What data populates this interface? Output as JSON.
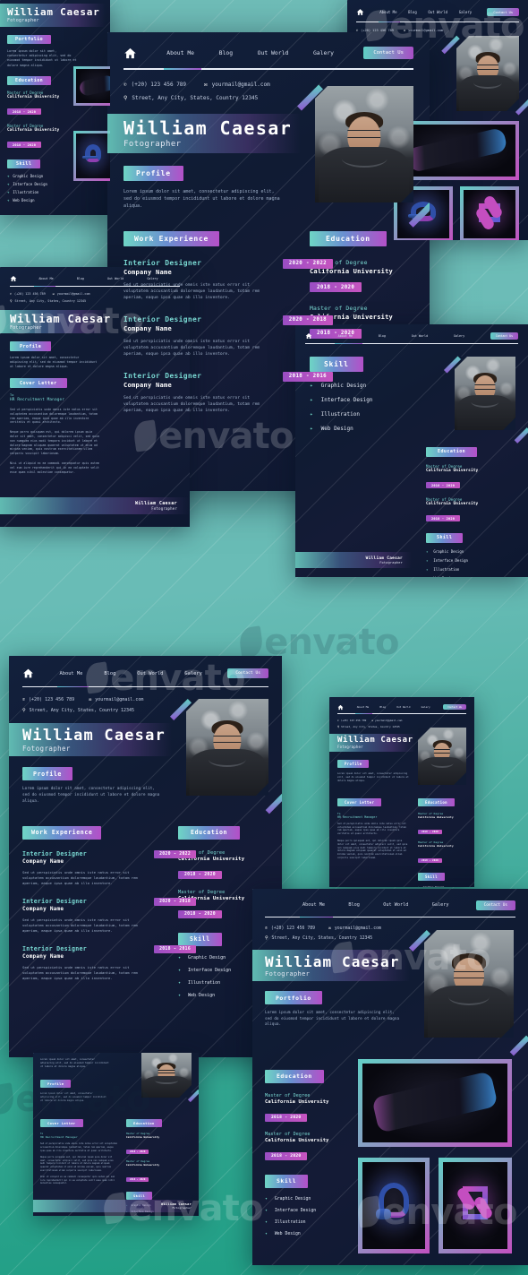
{
  "background": {
    "color_top": "#6fbdb8",
    "color_bottom": "#1f9e84"
  },
  "brand": {
    "accent_teal": "#6fd5c5",
    "accent_purple": "#b450c8",
    "accent_pink": "#c654c0",
    "card_bg": "#101b33"
  },
  "watermark": {
    "text": "envato"
  },
  "nav": {
    "home_icon": "home-icon",
    "links": [
      "About Me",
      "Blog",
      "Out World",
      "Galery"
    ],
    "cta": "Contact Us"
  },
  "contact": {
    "phone_icon": "phone-icon",
    "phone": "(+20) 123 456 789",
    "mail_icon": "mail-icon",
    "email": "yourmail@gmail.com",
    "pin_icon": "location-pin-icon",
    "address": "Street, Any City, States, Country 12345"
  },
  "identity": {
    "name": "William Caesar",
    "role": "Fotographer"
  },
  "sections": {
    "profile": "Profile",
    "work_experience": "Work Experience",
    "education": "Education",
    "skill": "Skill",
    "portfolio": "Portfolio",
    "cover_letter": "Cover Letter"
  },
  "profile": {
    "text": "Lorem ipsum dolor sit amet, consectetur adipiscing elit, sed do eiusmod tempor incididunt ut labore et dolore magna aliqua."
  },
  "work_experience": [
    {
      "title": "Interior Designer",
      "company": "Company Name",
      "date": "2020 - 2022",
      "text": "Sed ut perspiciatis unde omnis iste natus error sit voluptatem accusantium doloremque laudantium, totam rem aperiam, eaque ipsa quae ab illo inventore."
    },
    {
      "title": "Interior Designer",
      "company": "Company Name",
      "date": "2020 - 2018",
      "text": "Sed ut perspiciatis unde omnis iste natus error sit voluptatem accusantium doloremque laudantium, totam rem aperiam, eaque ipsa quae ab illo inventore."
    },
    {
      "title": "Interior Designer",
      "company": "Company Name",
      "date": "2018 - 2016",
      "text": "Sed ut perspiciatis unde omnis iste natus error sit voluptatem accusantium doloremque laudantium, totam rem aperiam, eaque ipsa quae ab illo inventore."
    }
  ],
  "education": [
    {
      "degree": "Master of Degree",
      "school": "California University",
      "date": "2018 - 2020"
    },
    {
      "degree": "Master of Degree",
      "school": "California University",
      "date": "2018 - 2020"
    }
  ],
  "skills": [
    "Graphic Design",
    "Interface Design",
    "Illustration",
    "Web Design"
  ],
  "cover_letter": {
    "to_label": "To",
    "to_value": "HR Recruitment Manager",
    "paragraphs": [
      "Sed ut perspiciatis unde omnis iste natus error sit voluptatem accusantium doloremque laudantium, totam rem aperiam, eaque ipsa quae ab illo inventore veritatis et quasi architecto.",
      "Neque porro quisquam est, qui dolorem ipsum quia dolor sit amet, consectetur adipisci velit, sed quia non numquam eius modi tempora incidunt ut labore et dolore magnam aliquam quaerat voluptatem ut enim ad minima veniam, quis nostrum exercitationem ullam corporis suscipit laboriosam.",
      "Nisi ut aliquid ex ea commodi consequatur quis autem vel eum iure reprehenderit qui in ea voluptate velit esse quam nihil molestiae consequatur."
    ],
    "sign_name": "William Caesar",
    "sign_role": "Fotographer"
  },
  "portfolio_items": [
    "gamepad-shot",
    "headphone-shot",
    "earbuds-shot"
  ]
}
